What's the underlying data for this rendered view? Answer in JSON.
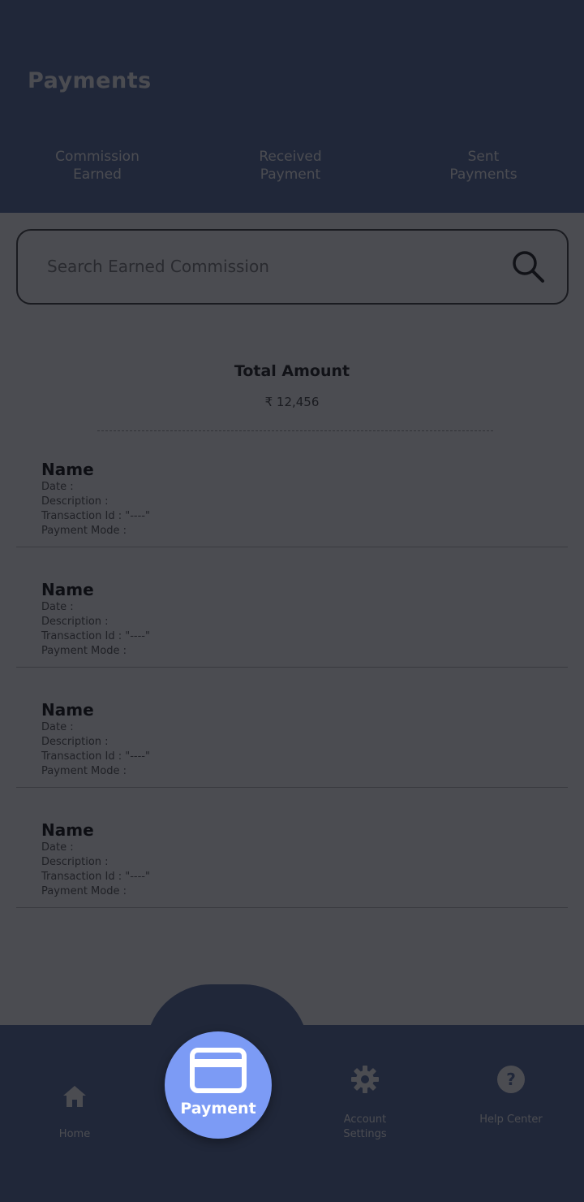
{
  "header": {
    "title": "Payments",
    "tabs": [
      {
        "label": "Commission\nEarned"
      },
      {
        "label": "Received\nPayment"
      },
      {
        "label": "Sent\nPayments"
      }
    ]
  },
  "search": {
    "placeholder": "Search Earned Commission",
    "icon": "search-icon"
  },
  "summary": {
    "total_label": "Total Amount",
    "total_value": "₹ 12,456"
  },
  "transactions": [
    {
      "name": "Name",
      "date": "Date :",
      "description": "Description :",
      "transaction_id": "Transaction Id : \"----\"",
      "payment_mode": "Payment Mode :"
    },
    {
      "name": "Name",
      "date": "Date :",
      "description": "Description :",
      "transaction_id": "Transaction Id : \"----\"",
      "payment_mode": "Payment Mode :"
    },
    {
      "name": "Name",
      "date": "Date :",
      "description": "Description :",
      "transaction_id": "Transaction Id : \"----\"",
      "payment_mode": "Payment Mode :"
    },
    {
      "name": "Name",
      "date": "Date :",
      "description": "Description :",
      "transaction_id": "Transaction Id : \"----\"",
      "payment_mode": "Payment Mode :"
    }
  ],
  "bottom_nav": {
    "home": {
      "label": "Home",
      "icon": "home-icon"
    },
    "payment": {
      "label": "Payment",
      "icon": "card-icon"
    },
    "settings": {
      "label": "Account\nSettings",
      "icon": "gear-icon"
    },
    "support": {
      "label": "Help Center",
      "icon": "help-icon"
    }
  },
  "colors": {
    "header_bg": "#5a6fa3",
    "nav_bg": "#5a6fa3",
    "fab_bg": "#7c9bf5",
    "overlay": "rgba(12,14,20,0.74)"
  }
}
